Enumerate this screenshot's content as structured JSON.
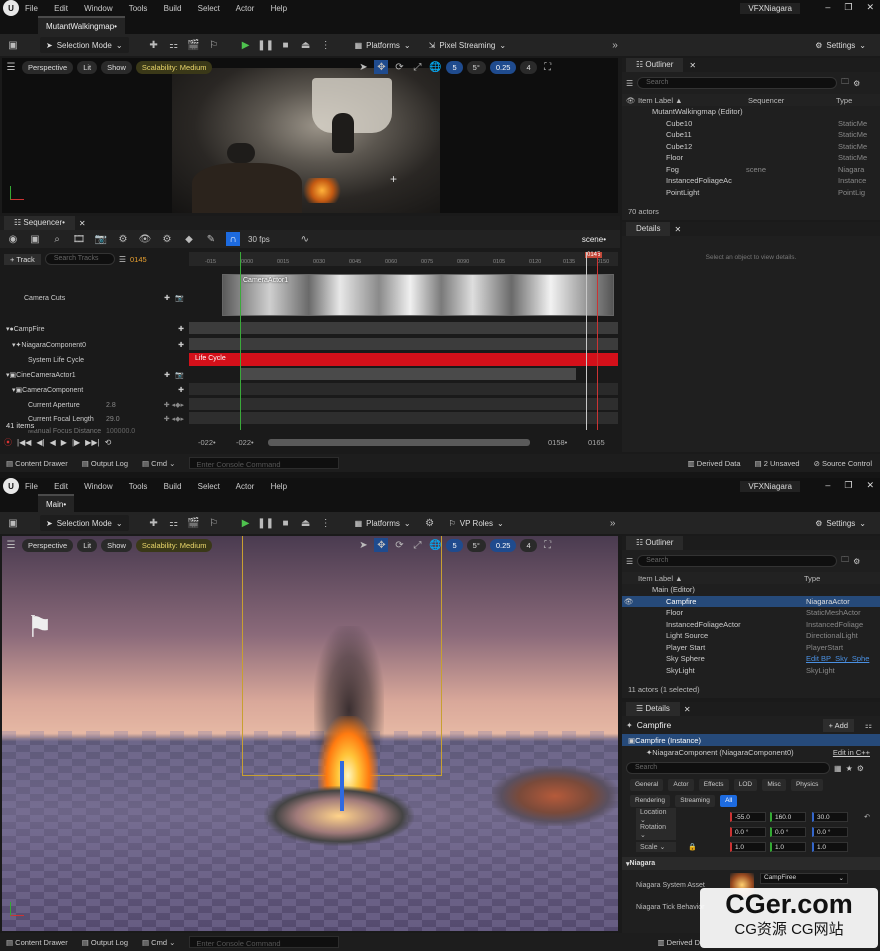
{
  "top": {
    "menu": [
      "File",
      "Edit",
      "Window",
      "Tools",
      "Build",
      "Select",
      "Actor",
      "Help"
    ],
    "project": "VFXNiagara",
    "map_tab": "MutantWalkingmap•",
    "toolbar": {
      "mode": "Selection Mode",
      "platforms": "Platforms",
      "pixel_streaming": "Pixel Streaming",
      "settings": "Settings"
    },
    "viewport": {
      "perspective": "Perspective",
      "lit": "Lit",
      "show": "Show",
      "scalability": "Scalability: Medium",
      "grid": "5",
      "angle": "5°",
      "scale": "0.25",
      "cams": "4"
    },
    "outliner": {
      "title": "Outliner",
      "search": "Search",
      "col_label": "Item Label ▲",
      "col_seq": "Sequencer",
      "col_type": "Type",
      "rows": [
        {
          "label": "MutantWalkingmap (Editor)",
          "seq": "",
          "type": ""
        },
        {
          "label": "Cube10",
          "seq": "",
          "type": "StaticMe"
        },
        {
          "label": "Cube11",
          "seq": "",
          "type": "StaticMe"
        },
        {
          "label": "Cube12",
          "seq": "",
          "type": "StaticMe"
        },
        {
          "label": "Floor",
          "seq": "",
          "type": "StaticMe"
        },
        {
          "label": "Fog",
          "seq": "scene",
          "type": "Niagara"
        },
        {
          "label": "InstancedFoliageAc",
          "seq": "",
          "type": "Instance"
        },
        {
          "label": "PointLight",
          "seq": "",
          "type": "PointLig"
        }
      ],
      "count": "70 actors"
    },
    "details": {
      "title": "Details",
      "empty": "Select an object to view details."
    },
    "sequencer": {
      "title": "Sequencer•",
      "fps": "30 fps",
      "scene": "scene•",
      "track_btn": "+ Track",
      "search": "Search Tracks",
      "frame": "0145",
      "ticks": [
        "-015",
        "0000",
        "0015",
        "0030",
        "0045",
        "0060",
        "0075",
        "0090",
        "0105",
        "0120",
        "0135",
        "0150"
      ],
      "playhead": "0145",
      "tracks": [
        {
          "label": "Camera Cuts",
          "indent": 0
        },
        {
          "label": "CampFire",
          "indent": 0
        },
        {
          "label": "NiagaraComponent0",
          "indent": 1
        },
        {
          "label": "System Life Cycle",
          "indent": 2
        },
        {
          "label": "CineCameraActor1",
          "indent": 0
        },
        {
          "label": "CameraComponent",
          "indent": 1
        },
        {
          "label": "Current Aperture",
          "indent": 2,
          "value": "2.8"
        },
        {
          "label": "Current Focal Length",
          "indent": 2,
          "value": "29.0"
        },
        {
          "label": "Manual Focus Distance",
          "indent": 2,
          "value": "100000.0"
        }
      ],
      "items": "41 items",
      "clip_label": "CameraActor1",
      "lifecycle": "Life Cycle",
      "range_start": "-022•",
      "range_start2": "-022•",
      "range_end": "0158•",
      "range_end2": "0165"
    },
    "status": {
      "drawer": "Content Drawer",
      "output": "Output Log",
      "cmd": "Cmd",
      "console": "Enter Console Command",
      "derived": "Derived Data",
      "unsaved": "2 Unsaved",
      "source": "Source Control"
    }
  },
  "bottom": {
    "menu": [
      "File",
      "Edit",
      "Window",
      "Tools",
      "Build",
      "Select",
      "Actor",
      "Help"
    ],
    "project": "VFXNiagara",
    "map_tab": "Main•",
    "toolbar": {
      "mode": "Selection Mode",
      "platforms": "Platforms",
      "vp_roles": "VP Roles",
      "settings": "Settings"
    },
    "viewport": {
      "perspective": "Perspective",
      "lit": "Lit",
      "show": "Show",
      "scalability": "Scalability: Medium",
      "grid": "5",
      "angle": "5°",
      "scale": "0.25",
      "cams": "4"
    },
    "outliner": {
      "title": "Outliner",
      "search": "Search",
      "col_label": "Item Label ▲",
      "col_type": "Type",
      "rows": [
        {
          "label": "Main (Editor)",
          "type": ""
        },
        {
          "label": "Campfire",
          "type": "NiagaraActor",
          "selected": true
        },
        {
          "label": "Floor",
          "type": "StaticMeshActor"
        },
        {
          "label": "InstancedFoliageActor",
          "type": "InstancedFoliage"
        },
        {
          "label": "Light Source",
          "type": "DirectionalLight"
        },
        {
          "label": "Player Start",
          "type": "PlayerStart"
        },
        {
          "label": "Sky Sphere",
          "type": "Edit BP_Sky_Sphe"
        },
        {
          "label": "SkyLight",
          "type": "SkyLight"
        }
      ],
      "count": "11 actors (1 selected)"
    },
    "details": {
      "title": "Details",
      "actor": "Campfire",
      "add": "+ Add",
      "instance": "Campfire (Instance)",
      "component": "NiagaraComponent (NiagaraComponent0)",
      "edit_cpp": "Edit in C++",
      "search": "Search",
      "cats_row1": [
        "General",
        "Actor",
        "Effects",
        "LOD",
        "Misc",
        "Physics"
      ],
      "cats_row2": [
        "Rendering",
        "Streaming",
        "All"
      ],
      "location": {
        "label": "Location",
        "x": "-55.0",
        "y": "160.0",
        "z": "30.0"
      },
      "rotation": {
        "label": "Rotation",
        "x": "0.0 °",
        "y": "0.0 °",
        "z": "0.0 °"
      },
      "scale": {
        "label": "Scale",
        "x": "1.0",
        "y": "1.0",
        "z": "1.0"
      },
      "section": "Niagara",
      "asset_label": "Niagara System Asset",
      "asset_value": "CampFiree",
      "tick_label": "Niagara Tick Behavior"
    },
    "status": {
      "drawer": "Content Drawer",
      "output": "Output Log",
      "cmd": "Cmd",
      "console": "Enter Console Command",
      "derived": "Derived D"
    }
  },
  "watermark": {
    "line1": "CGer.com",
    "line2": "CG资源 CG网站"
  }
}
